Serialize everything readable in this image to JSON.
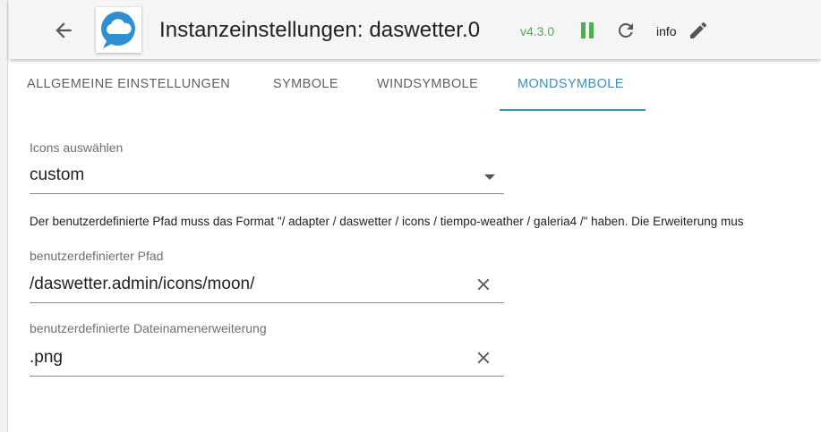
{
  "header": {
    "title": "Instanzeinstellungen: daswetter.0",
    "version": "v4.3.0",
    "info_label": "info",
    "colors": {
      "version": "#4caf50",
      "pause": "#4caf50",
      "accent": "#3f8dbd",
      "logo_bg": "#2f8fd0"
    },
    "icons": {
      "back": "arrow-left-icon",
      "logo": "cloud-chat-logo",
      "pause": "pause-icon",
      "reload": "reload-icon",
      "edit": "pencil-icon"
    }
  },
  "tabs": [
    {
      "label": "ALLGEMEINE EINSTELLUNGEN",
      "active": false
    },
    {
      "label": "SYMBOLE",
      "active": false
    },
    {
      "label": "WINDSYMBOLE",
      "active": false
    },
    {
      "label": "MONDSYMBOLE",
      "active": true
    }
  ],
  "form": {
    "icons_select": {
      "label": "Icons auswählen",
      "value": "custom"
    },
    "help_text": "Der benutzerdefinierte Pfad muss das Format \"/ adapter / daswetter / icons / tiempo-weather / galeria4 /\" haben. Die Erweiterung mus",
    "custom_path": {
      "label": "benutzerdefinierter Pfad",
      "value": "/daswetter.admin/icons/moon/"
    },
    "custom_extension": {
      "label": "benutzerdefinierte Dateinamenerweiterung",
      "value": ".png"
    }
  }
}
